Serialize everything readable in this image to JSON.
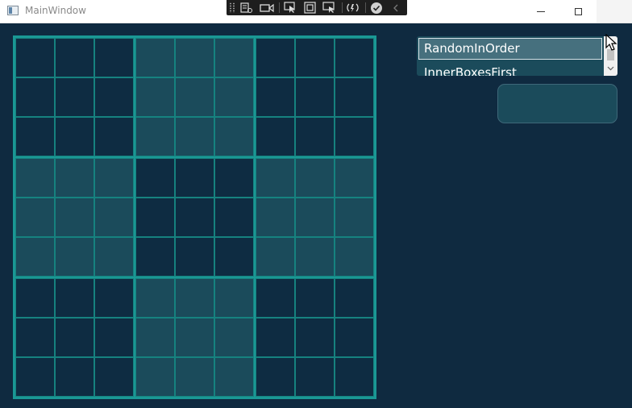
{
  "window": {
    "title": "MainWindow",
    "controls": [
      "minimize",
      "maximize",
      "close"
    ]
  },
  "debug_toolbar": {
    "tools": [
      "live-visual-tree-icon",
      "record-icon",
      "select-element-icon",
      "display-adorners-icon",
      "track-focus-icon",
      "hot-reload-icon",
      "binding-check-icon",
      "collapse-chevron-icon"
    ]
  },
  "board": {
    "size": 9,
    "box_shading": [
      [
        "dark",
        "light",
        "dark"
      ],
      [
        "light",
        "dark",
        "light"
      ],
      [
        "dark",
        "light",
        "dark"
      ]
    ],
    "colors": {
      "dark_cell": "#0e2c42",
      "light_cell": "#1b4b5b",
      "grid_line": "#1a9895",
      "background": "#0f2a40"
    }
  },
  "order_list": {
    "items": [
      "RandomInOrder",
      "InnerBoxesFirst"
    ],
    "selected": "RandomInOrder"
  },
  "action_button": {
    "label": ""
  }
}
